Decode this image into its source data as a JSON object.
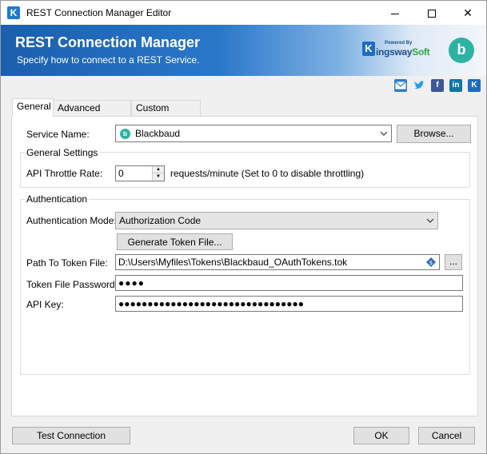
{
  "window": {
    "title": "REST Connection Manager Editor",
    "app_icon_letter": "K",
    "controls": {
      "close": "✕"
    }
  },
  "banner": {
    "title": "REST Connection Manager",
    "subtitle": "Specify how to connect to a REST Service.",
    "kingsway": {
      "powered": "Powered By",
      "k": "K",
      "name_main": "ingsway",
      "name_soft": "Soft"
    },
    "blackbaud_logo_letter": "b"
  },
  "social": {
    "icons": [
      "mail-icon",
      "twitter-icon",
      "facebook-icon",
      "linkedin-icon",
      "kingswaysoft-icon"
    ],
    "tw": "🐦",
    "fb": "f",
    "li": "in",
    "ks": "K"
  },
  "tabs": [
    {
      "label": "General",
      "active": true
    },
    {
      "label": "Advanced Settings",
      "active": false
    },
    {
      "label": "Custom Headers",
      "active": false
    }
  ],
  "general": {
    "service_name_label": "Service Name:",
    "service_name_value": "Blackbaud",
    "service_logo_letter": "b",
    "browse_label": "Browse...",
    "general_settings_title": "General Settings",
    "throttle_label": "API Throttle Rate:",
    "throttle_value": "0",
    "throttle_hint": "requests/minute (Set to 0 to disable throttling)",
    "authentication_title": "Authentication",
    "auth_mode_label": "Authentication Mode:",
    "auth_mode_value": "Authorization Code",
    "generate_token_label": "Generate Token File...",
    "token_path_label": "Path To Token File:",
    "token_path_value": "D:\\Users\\Myfiles\\Tokens\\Blackbaud_OAuthTokens.tok",
    "token_path_browse": "...",
    "token_password_label": "Token File Password:",
    "token_password_value": "●●●●",
    "api_key_label": "API Key:",
    "api_key_value": "●●●●●●●●●●●●●●●●●●●●●●●●●●●●●●●●"
  },
  "footer": {
    "test_connection": "Test Connection",
    "ok": "OK",
    "cancel": "Cancel"
  },
  "colors": {
    "banner_start": "#1b5fae",
    "accent_blue": "#1d6cc4",
    "blackbaud_teal": "#2db3a3"
  }
}
